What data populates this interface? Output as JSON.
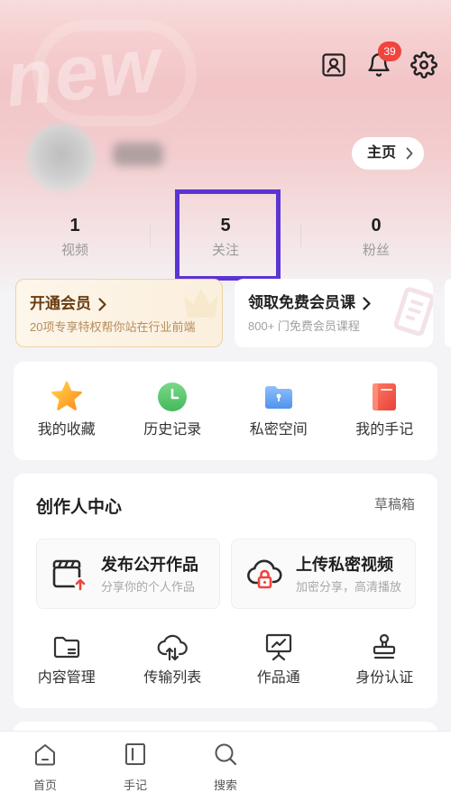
{
  "colors": {
    "accent": "#5b34d4",
    "badge": "#f0443c",
    "vip": "#6a3b10",
    "vipsub": "#b58c5c"
  },
  "watermark": "new",
  "header": {
    "icons": [
      "contact-card-icon",
      "bell-icon",
      "gear-icon"
    ],
    "notification_count": "39"
  },
  "profile": {
    "home_button_label": "主页"
  },
  "stats": [
    {
      "value": "1",
      "label": "视频"
    },
    {
      "value": "5",
      "label": "关注"
    },
    {
      "value": "0",
      "label": "粉丝"
    }
  ],
  "membership": [
    {
      "title": "开通会员",
      "subtitle": "20项专享特权帮你站在行业前端"
    },
    {
      "title": "领取免费会员课",
      "subtitle": "800+ 门免费会员课程"
    }
  ],
  "quick_access": [
    {
      "label": "我的收藏",
      "icon": "star-icon"
    },
    {
      "label": "历史记录",
      "icon": "clock-icon"
    },
    {
      "label": "私密空间",
      "icon": "private-folder-icon"
    },
    {
      "label": "我的手记",
      "icon": "notebook-icon"
    }
  ],
  "creator_center": {
    "title": "创作人中心",
    "drafts_label": "草稿箱",
    "publish": [
      {
        "title": "发布公开作品",
        "subtitle": "分享你的个人作品",
        "icon": "clapperboard-upload-icon"
      },
      {
        "title": "上传私密视频",
        "subtitle": "加密分享，高清播放",
        "icon": "cloud-lock-icon"
      }
    ],
    "tools": [
      {
        "label": "内容管理",
        "icon": "folder-icon"
      },
      {
        "label": "传输列表",
        "icon": "cloud-transfer-icon"
      },
      {
        "label": "作品通",
        "icon": "presentation-board-icon"
      },
      {
        "label": "身份认证",
        "icon": "stamp-icon"
      }
    ]
  },
  "bottom_nav": [
    {
      "label": "首页",
      "icon": "home-icon"
    },
    {
      "label": "手记",
      "icon": "note-icon"
    },
    {
      "label": "搜索",
      "icon": "search-icon"
    }
  ]
}
